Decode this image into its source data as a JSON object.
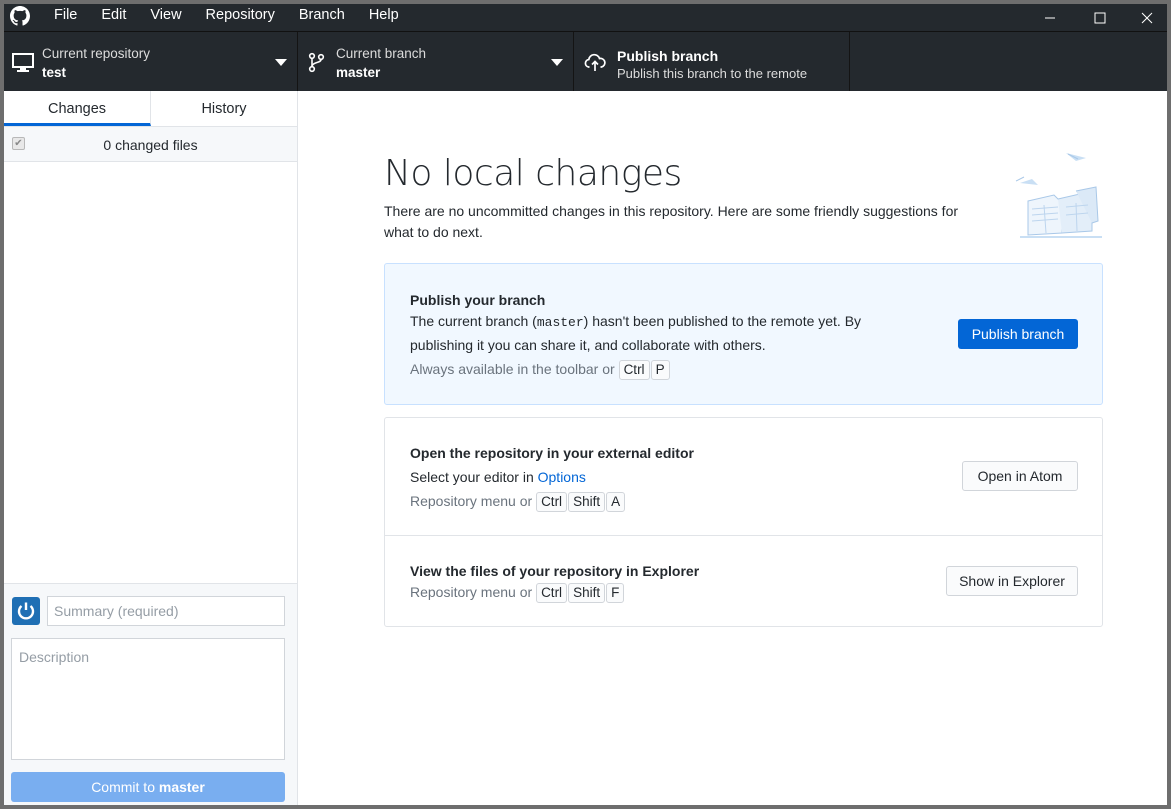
{
  "menu": [
    "File",
    "Edit",
    "View",
    "Repository",
    "Branch",
    "Help"
  ],
  "toolbar": {
    "repository": {
      "title": "Current repository",
      "value": "test"
    },
    "branch": {
      "title": "Current branch",
      "value": "master"
    },
    "publish": {
      "title": "Publish branch",
      "subtitle": "Publish this branch to the remote"
    }
  },
  "sidebar": {
    "tabs": [
      "Changes",
      "History"
    ],
    "active_tab": "Changes",
    "changed_files": "0 changed files",
    "summary_placeholder": "Summary (required)",
    "description_placeholder": "Description",
    "commit_prefix": "Commit to ",
    "commit_branch": "master"
  },
  "main": {
    "title": "No local changes",
    "subtitle": "There are no uncommitted changes in this repository. Here are some friendly suggestions for what to do next.",
    "publish_card": {
      "title": "Publish your branch",
      "text_before": "The current branch (",
      "branch": "master",
      "text_after": ") hasn't been published to the remote yet. By publishing it you can share it, and collaborate with others.",
      "hint": "Always available in the toolbar or",
      "keys": [
        "Ctrl",
        "P"
      ],
      "button": "Publish branch"
    },
    "editor_card": {
      "title": "Open the repository in your external editor",
      "text": "Select your editor in ",
      "link": "Options",
      "hint": "Repository menu or",
      "keys": [
        "Ctrl",
        "Shift",
        "A"
      ],
      "button": "Open in Atom"
    },
    "explorer_card": {
      "title": "View the files of your repository in Explorer",
      "hint": "Repository menu or",
      "keys": [
        "Ctrl",
        "Shift",
        "F"
      ],
      "button": "Show in Explorer"
    }
  },
  "colors": {
    "accent": "#0366d6",
    "toolbar": "#24292e",
    "publish_card": "#f1f8ff"
  }
}
